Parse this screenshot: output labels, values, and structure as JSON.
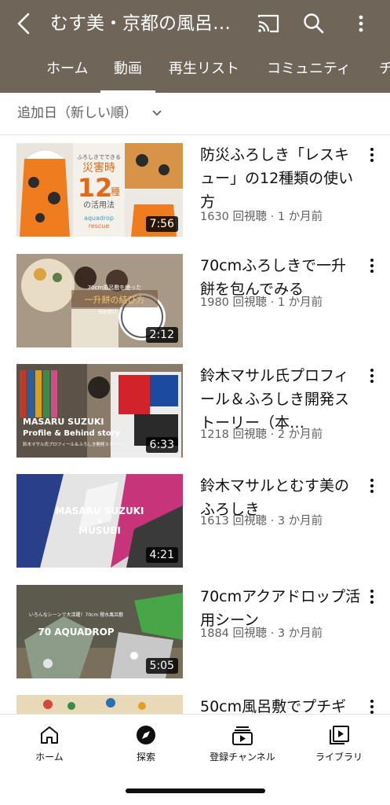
{
  "header": {
    "channel_title": "むす美・京都の風呂…",
    "tabs": [
      "ホーム",
      "動画",
      "再生リスト",
      "コミュニティ",
      "チ"
    ],
    "active_tab": "動画",
    "colors": {
      "header_bg": "#6f6558",
      "text": "#ffffff"
    }
  },
  "sort": {
    "label": "追加日（新しい順）"
  },
  "videos": [
    {
      "title": "防災ふろしき「レスキュー」の12種類の使い方",
      "meta": "1630 回視聴 · 1 か月前",
      "duration": "7:56",
      "thumb_text": {
        "line1": "ふろしきでできる",
        "line2": "災害時",
        "big": "12",
        "line3": "種",
        "line4": "の活用法",
        "brand1": "aquadrop",
        "brand2": "rescue"
      }
    },
    {
      "title": "70cmふろしきで一升餅を包んでみる",
      "meta": "1980 回視聴 · 1 か月前",
      "duration": "2:12",
      "thumb_text": {
        "line1": "70cm風呂敷を使った",
        "line2": "一升餅の結び方",
        "line3": "斜め掛けタイプ"
      }
    },
    {
      "title": "鈴木マサル氏プロフィール＆ふろしき開発ストーリー（本…",
      "meta": "1218 回視聴 · 2 か月前",
      "duration": "6:33",
      "thumb_text": {
        "line1": "MASARU SUZUKI",
        "line2": "Profile & Behind story",
        "line3": "鈴木マサル氏プロフィール＆ふろしき開発ストーリー"
      }
    },
    {
      "title": "鈴木マサルとむす美のふろしき",
      "meta": "1613 回視聴 · 3 か月前",
      "duration": "4:21",
      "thumb_text": {
        "line1": "MASARU SUZUKI",
        "line2": "×",
        "line3": "MUSUBI"
      }
    },
    {
      "title": "70cmアクアドロップ活用シーン",
      "meta": "1884 回視聴 · 3 か月前",
      "duration": "5:05",
      "thumb_text": {
        "line1": "いろんなシーンで大活躍！70cm 撥水風呂敷",
        "line2": "70 AQUADROP"
      }
    },
    {
      "title": "50cm風呂敷でプチギ",
      "meta": "",
      "duration": "",
      "thumb_text": {}
    }
  ],
  "bottom_nav": [
    {
      "label": "ホーム",
      "icon": "home-icon"
    },
    {
      "label": "探索",
      "icon": "compass-icon"
    },
    {
      "label": "登録チャンネル",
      "icon": "subscriptions-icon"
    },
    {
      "label": "ライブラリ",
      "icon": "library-icon"
    }
  ]
}
